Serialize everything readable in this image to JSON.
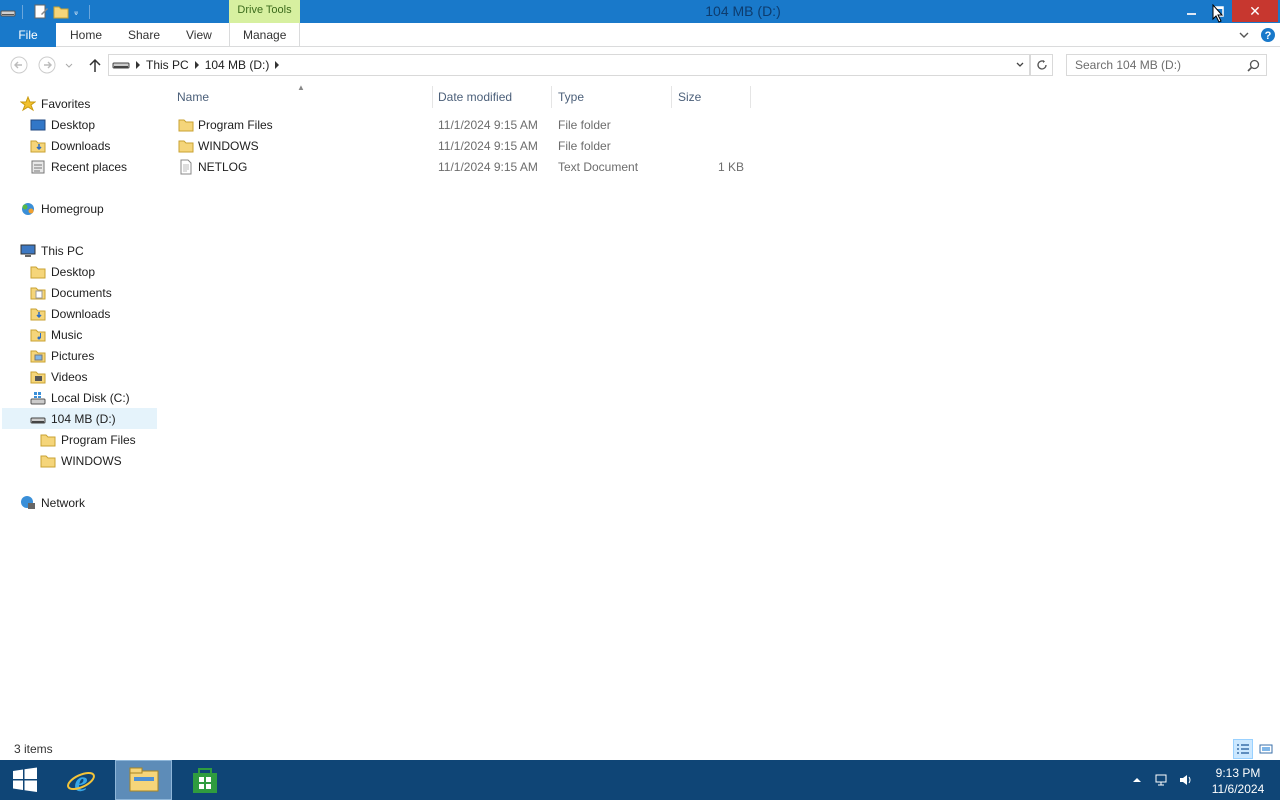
{
  "window": {
    "title": "104 MB (D:)",
    "contextual_tab": "Drive Tools",
    "close_glyph": "✕"
  },
  "ribbon": {
    "tabs": [
      "File",
      "Home",
      "Share",
      "View",
      "Manage"
    ]
  },
  "address": {
    "crumbs": [
      "This PC",
      "104 MB (D:)"
    ],
    "search_placeholder": "Search 104 MB (D:)"
  },
  "nav": {
    "favorites": {
      "label": "Favorites",
      "items": [
        "Desktop",
        "Downloads",
        "Recent places"
      ]
    },
    "homegroup": "Homegroup",
    "this_pc": {
      "label": "This PC",
      "items": [
        "Desktop",
        "Documents",
        "Downloads",
        "Music",
        "Pictures",
        "Videos",
        "Local Disk (C:)",
        "104 MB (D:)"
      ],
      "selected": "104 MB (D:)",
      "subitems": [
        "Program Files",
        "WINDOWS"
      ]
    },
    "network": "Network"
  },
  "columns": [
    "Name",
    "Date modified",
    "Type",
    "Size"
  ],
  "files": [
    {
      "name": "Program Files",
      "date": "11/1/2024 9:15 AM",
      "type": "File folder",
      "size": "",
      "icon": "folder-icon"
    },
    {
      "name": "WINDOWS",
      "date": "11/1/2024 9:15 AM",
      "type": "File folder",
      "size": "",
      "icon": "folder-icon"
    },
    {
      "name": "NETLOG",
      "date": "11/1/2024 9:15 AM",
      "type": "Text Document",
      "size": "1 KB",
      "icon": "text-file-icon"
    }
  ],
  "status": {
    "count": "3 items"
  },
  "taskbar": {
    "time": "9:13 PM",
    "date": "11/6/2024"
  },
  "colors": {
    "titlebar": "#1979ca",
    "drive_tools": "#d7f0a0",
    "close": "#c7372f",
    "taskbar": "#0f4576",
    "selection": "#e5f3fb"
  }
}
